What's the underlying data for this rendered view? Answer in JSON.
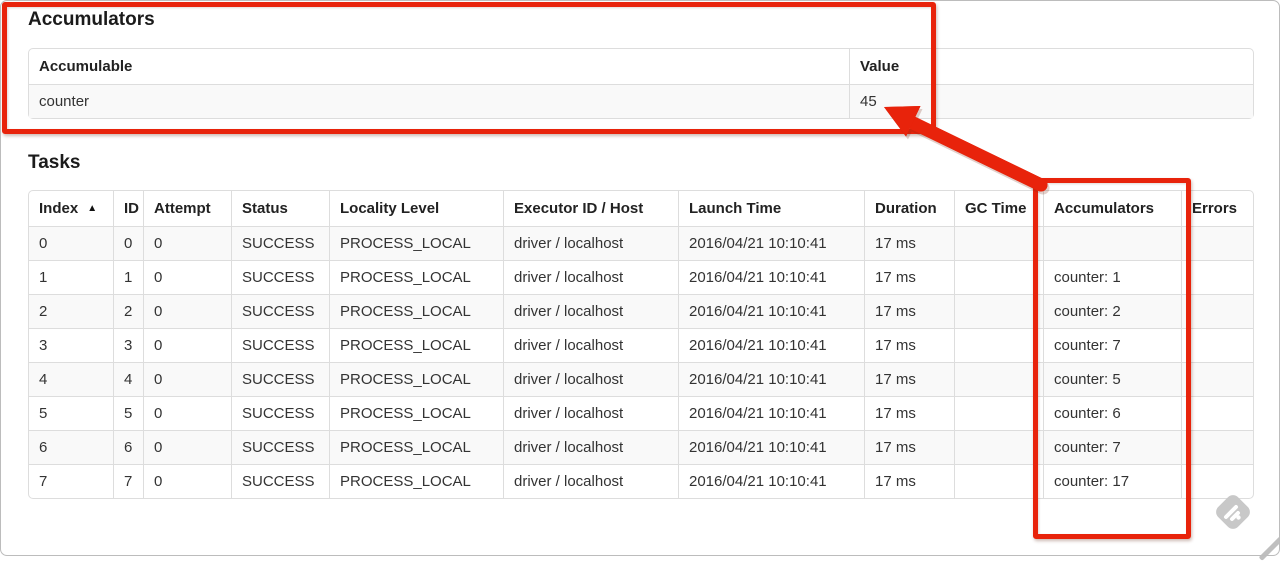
{
  "annotation": {
    "highlight_color": "#e8230b",
    "note": "red boxes around accumulator value and Accumulators column, arrow pointing at total value"
  },
  "accumulators_section": {
    "heading": "Accumulators",
    "columns": [
      "Accumulable",
      "Value"
    ],
    "rows": [
      {
        "accumulable": "counter",
        "value": "45"
      }
    ]
  },
  "tasks_section": {
    "heading": "Tasks",
    "columns": [
      {
        "label": "Index",
        "sort_icon": "▲"
      },
      {
        "label": "ID"
      },
      {
        "label": "Attempt"
      },
      {
        "label": "Status"
      },
      {
        "label": "Locality Level"
      },
      {
        "label": "Executor ID / Host"
      },
      {
        "label": "Launch Time"
      },
      {
        "label": "Duration"
      },
      {
        "label": "GC Time"
      },
      {
        "label": "Accumulators"
      },
      {
        "label": "Errors"
      }
    ],
    "rows": [
      [
        "0",
        "0",
        "0",
        "SUCCESS",
        "PROCESS_LOCAL",
        "driver / localhost",
        "2016/04/21 10:10:41",
        "17 ms",
        "",
        "",
        ""
      ],
      [
        "1",
        "1",
        "0",
        "SUCCESS",
        "PROCESS_LOCAL",
        "driver / localhost",
        "2016/04/21 10:10:41",
        "17 ms",
        "",
        "counter: 1",
        ""
      ],
      [
        "2",
        "2",
        "0",
        "SUCCESS",
        "PROCESS_LOCAL",
        "driver / localhost",
        "2016/04/21 10:10:41",
        "17 ms",
        "",
        "counter: 2",
        ""
      ],
      [
        "3",
        "3",
        "0",
        "SUCCESS",
        "PROCESS_LOCAL",
        "driver / localhost",
        "2016/04/21 10:10:41",
        "17 ms",
        "",
        "counter: 7",
        ""
      ],
      [
        "4",
        "4",
        "0",
        "SUCCESS",
        "PROCESS_LOCAL",
        "driver / localhost",
        "2016/04/21 10:10:41",
        "17 ms",
        "",
        "counter: 5",
        ""
      ],
      [
        "5",
        "5",
        "0",
        "SUCCESS",
        "PROCESS_LOCAL",
        "driver / localhost",
        "2016/04/21 10:10:41",
        "17 ms",
        "",
        "counter: 6",
        ""
      ],
      [
        "6",
        "6",
        "0",
        "SUCCESS",
        "PROCESS_LOCAL",
        "driver / localhost",
        "2016/04/21 10:10:41",
        "17 ms",
        "",
        "counter: 7",
        ""
      ],
      [
        "7",
        "7",
        "0",
        "SUCCESS",
        "PROCESS_LOCAL",
        "driver / localhost",
        "2016/04/21 10:10:41",
        "17 ms",
        "",
        "counter: 17",
        ""
      ]
    ]
  },
  "watermark": {
    "name": "feedly-diamond"
  }
}
